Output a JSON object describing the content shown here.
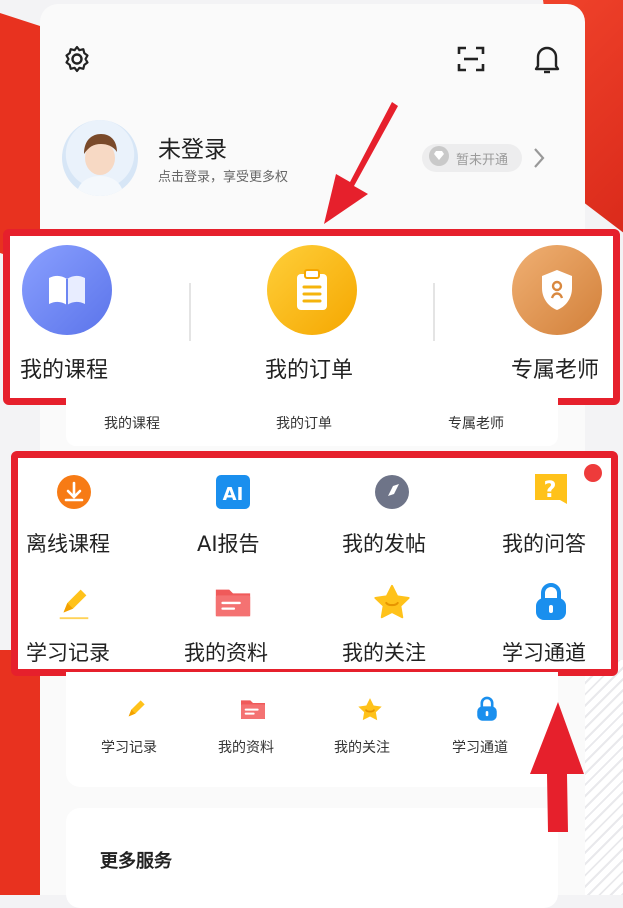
{
  "header": {
    "settings_icon": "gear-icon",
    "scan_icon": "scan-icon",
    "bell_icon": "bell-icon"
  },
  "profile": {
    "title": "未登录",
    "subtitle": "点击登录，享受更多权",
    "vip_label": "暂未开通"
  },
  "primary": {
    "items": [
      {
        "label": "我的课程",
        "icon": "book-icon",
        "color": "#6d86f2"
      },
      {
        "label": "我的订单",
        "icon": "clipboard-icon",
        "color": "#f9b60c"
      },
      {
        "label": "专属老师",
        "icon": "shield-icon",
        "color": "#e0904d"
      }
    ],
    "small_labels": [
      "我的课程",
      "我的订单",
      "专属老师"
    ]
  },
  "grid": {
    "row1": [
      {
        "label": "离线课程",
        "icon": "download-icon"
      },
      {
        "label": "AI报告",
        "icon": "ai-icon"
      },
      {
        "label": "我的发帖",
        "icon": "compass-icon"
      },
      {
        "label": "我的问答",
        "icon": "question-icon"
      }
    ],
    "row2": [
      {
        "label": "学习记录",
        "icon": "pencil-icon"
      },
      {
        "label": "我的资料",
        "icon": "folder-icon"
      },
      {
        "label": "我的关注",
        "icon": "star-icon"
      },
      {
        "label": "学习通道",
        "icon": "lock-icon"
      }
    ],
    "small_row": [
      "学习记录",
      "我的资料",
      "我的关注",
      "学习通道"
    ]
  },
  "more": {
    "title": "更多服务"
  }
}
